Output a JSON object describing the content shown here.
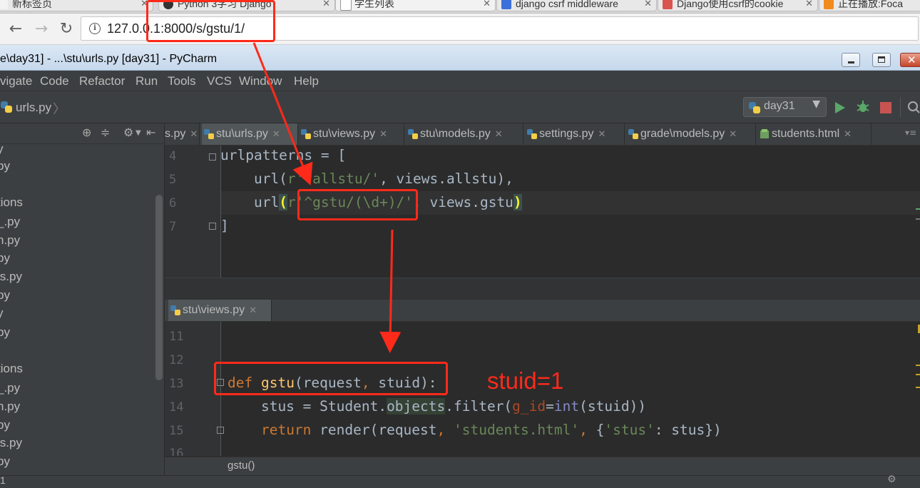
{
  "browser": {
    "tabs": [
      {
        "label": "新标签页",
        "favicon_color": "#f3f3f3"
      },
      {
        "label": "Python 3学习 Django",
        "favicon_color": "#333333"
      },
      {
        "label": "学生列表",
        "favicon_color": "#e8e8e8"
      },
      {
        "label": "django csrf middleware",
        "favicon_color": "#3b6fd9"
      },
      {
        "label": "Django使用csrf的cookie",
        "favicon_color": "#d9534f"
      },
      {
        "label": "正在播放:Foca",
        "favicon_color": "#f28b1e"
      }
    ],
    "nav": {
      "back": "←",
      "forward": "→",
      "reload": "↻"
    },
    "url": "127.0.0.1:8000/s/gstu/1/",
    "info_icon": "i"
  },
  "ide": {
    "title": "e\\day31] - ...\\stu\\urls.py [day31] - PyCharm",
    "menu": [
      "vigate",
      "Code",
      "Refactor",
      "Run",
      "Tools",
      "VCS",
      "Window",
      "Help"
    ],
    "breadcrumb": "urls.py",
    "run_config": "day31",
    "project_tree": [
      "y",
      "py",
      "",
      "tions",
      "_.py",
      "n.py",
      "py",
      "ls.py",
      "py",
      "y",
      "py",
      "",
      "tions",
      "_.py",
      "n.py",
      "py",
      "ls.py",
      "py"
    ],
    "editor_tabs": [
      {
        "label": "s.py",
        "active": false
      },
      {
        "label": "stu\\urls.py",
        "active": true
      },
      {
        "label": "stu\\views.py",
        "active": false
      },
      {
        "label": "stu\\models.py",
        "active": false
      },
      {
        "label": "settings.py",
        "active": false
      },
      {
        "label": "grade\\models.py",
        "active": false
      },
      {
        "label": "students.html",
        "active": false
      }
    ],
    "top_editor": {
      "lines": [
        {
          "num": "4",
          "text": "urlpatterns = ["
        },
        {
          "num": "5",
          "text": "    url(r'^allstu/', views.allstu),"
        },
        {
          "num": "6",
          "text": "    url(r'^gstu/(\\d+)/', views.gstu)"
        },
        {
          "num": "7",
          "text": "]"
        }
      ]
    },
    "bottom_tab": "stu\\views.py",
    "bottom_editor": {
      "lines": [
        {
          "num": "11",
          "text": ""
        },
        {
          "num": "12",
          "text": ""
        },
        {
          "num": "13",
          "text": "def gstu(request, stuid):"
        },
        {
          "num": "14",
          "text": "    stus = Student.objects.filter(g_id=int(stuid))"
        },
        {
          "num": "15",
          "text": "    return render(request, 'students.html', {'stus': stus})"
        },
        {
          "num": "16",
          "text": ""
        }
      ]
    },
    "status_text": "gstu()",
    "bottom_left": "1"
  },
  "annotation": {
    "text": "stuid=1",
    "color": "#ff2a1a"
  }
}
